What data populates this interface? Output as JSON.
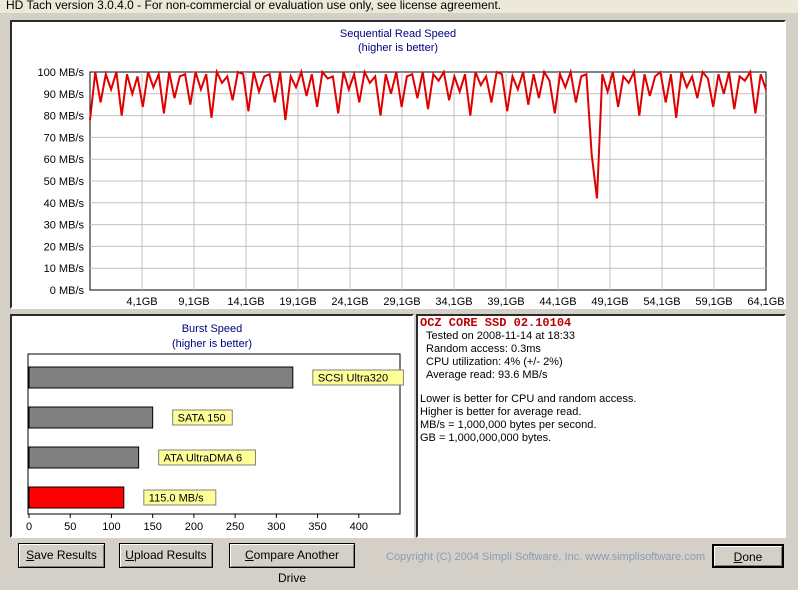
{
  "window": {
    "title": "HD Tach version 3.0.4.0  - For non-commercial or evaluation use only, see license agreement."
  },
  "colors": {
    "read_line": "#e00000",
    "burst_bar_current": "#ff0000",
    "burst_bar_reference": "#808080",
    "label_bg": "#ffff99",
    "title_text": "#000080"
  },
  "chart_data": [
    {
      "type": "line",
      "title": "Sequential Read Speed",
      "subtitle": "(higher is better)",
      "ylim": [
        0,
        100
      ],
      "y_ticks": [
        "0 MB/s",
        "10 MB/s",
        "20 MB/s",
        "30 MB/s",
        "40 MB/s",
        "50 MB/s",
        "60 MB/s",
        "70 MB/s",
        "80 MB/s",
        "90 MB/s",
        "100 MB/s"
      ],
      "xlim": [
        0,
        64
      ],
      "x_ticks": [
        "4,1GB",
        "9,1GB",
        "14,1GB",
        "19,1GB",
        "24,1GB",
        "29,1GB",
        "34,1GB",
        "39,1GB",
        "44,1GB",
        "49,1GB",
        "54,1GB",
        "59,1GB",
        "64,1GB"
      ],
      "grid": true,
      "series": [
        {
          "values_note": "",
          "x": [
            0,
            0.5,
            1,
            1.5,
            2,
            2.5,
            3,
            3.5,
            4,
            4.5,
            5,
            5.5,
            6,
            6.5,
            7,
            7.5,
            8,
            8.5,
            9,
            9.5,
            10,
            10.5,
            11,
            11.5,
            12,
            12.5,
            13,
            13.5,
            14,
            14.5,
            15,
            15.5,
            16,
            16.5,
            17,
            17.5,
            18,
            18.5,
            19,
            19.5,
            20,
            20.5,
            21,
            21.5,
            22,
            22.5,
            23,
            23.5,
            24,
            24.5,
            25,
            25.5,
            26,
            26.5,
            27,
            27.5,
            28,
            28.5,
            29,
            29.5,
            30,
            30.5,
            31,
            31.5,
            32,
            32.5,
            33,
            33.5,
            34,
            34.5,
            35,
            35.5,
            36,
            36.5,
            37,
            37.5,
            38,
            38.5,
            39,
            39.5,
            40,
            40.5,
            41,
            41.5,
            42,
            42.5,
            43,
            43.5,
            44,
            44.5,
            45,
            45.5,
            46,
            46.5,
            47,
            47.5,
            48,
            48.5,
            49,
            49.5,
            50,
            50.5,
            51,
            51.5,
            52,
            52.5,
            53,
            53.5,
            54,
            54.5,
            55,
            55.5,
            56,
            56.5,
            57,
            57.5,
            58,
            58.5,
            59,
            59.5,
            60,
            60.5,
            61,
            61.5,
            62,
            62.5,
            63,
            63.5,
            64
          ],
          "y": [
            78,
            100,
            86,
            99,
            92,
            100,
            80,
            99,
            90,
            98,
            84,
            100,
            93,
            99,
            81,
            100,
            88,
            98,
            99,
            85,
            100,
            92,
            99,
            79,
            100,
            95,
            98,
            87,
            100,
            99,
            82,
            100,
            91,
            98,
            99,
            86,
            100,
            78,
            98,
            93,
            100,
            89,
            99,
            84,
            100,
            97,
            98,
            81,
            100,
            92,
            99,
            86,
            100,
            95,
            98,
            80,
            99,
            90,
            100,
            84,
            98,
            99,
            88,
            100,
            83,
            99,
            96,
            100,
            87,
            98,
            91,
            99,
            80,
            100,
            94,
            98,
            86,
            100,
            99,
            82,
            98,
            92,
            100,
            85,
            99,
            88,
            100,
            96,
            81,
            99,
            93,
            100,
            86,
            98,
            99,
            62,
            42,
            99,
            91,
            100,
            84,
            98,
            95,
            100,
            80,
            99,
            89,
            98,
            100,
            86,
            99,
            79,
            100,
            93,
            98,
            88,
            100,
            97,
            84,
            99,
            90,
            100,
            83,
            98,
            96,
            100,
            81,
            99,
            92
          ]
        }
      ]
    },
    {
      "type": "bar",
      "orientation": "horizontal",
      "title": "Burst Speed",
      "subtitle": "(higher is better)",
      "xlim": [
        0,
        450
      ],
      "x_ticks": [
        "0",
        "50",
        "100",
        "150",
        "200",
        "250",
        "300",
        "350",
        "400"
      ],
      "categories": [
        "SCSI Ultra320",
        "SATA 150",
        "ATA UltraDMA 6",
        "115.0 MB/s"
      ],
      "values": [
        320,
        150,
        133,
        115
      ]
    }
  ],
  "info": {
    "drive_name": "OCZ CORE SSD 02.10104",
    "tested_on": "Tested on 2008-11-14 at 18:33",
    "random_access": "Random access: 0.3ms",
    "cpu_utilization": "CPU utilization: 4% (+/- 2%)",
    "average_read": "Average read: 93.6 MB/s",
    "note1": "Lower is better for CPU and random access.",
    "note2": "Higher is better for average read.",
    "note3": "MB/s = 1,000,000 bytes per second.",
    "note4": "GB = 1,000,000,000 bytes."
  },
  "buttons": {
    "save": {
      "accel": "S",
      "rest": "ave Results"
    },
    "upload": {
      "accel": "U",
      "rest": "pload Results"
    },
    "compare": {
      "accel": "C",
      "rest": "ompare Another Drive"
    },
    "done": {
      "accel": "D",
      "rest": "one"
    }
  },
  "footer": {
    "copyright": "Copyright (C) 2004 Simpli Software, Inc. www.simplisoftware.com"
  }
}
